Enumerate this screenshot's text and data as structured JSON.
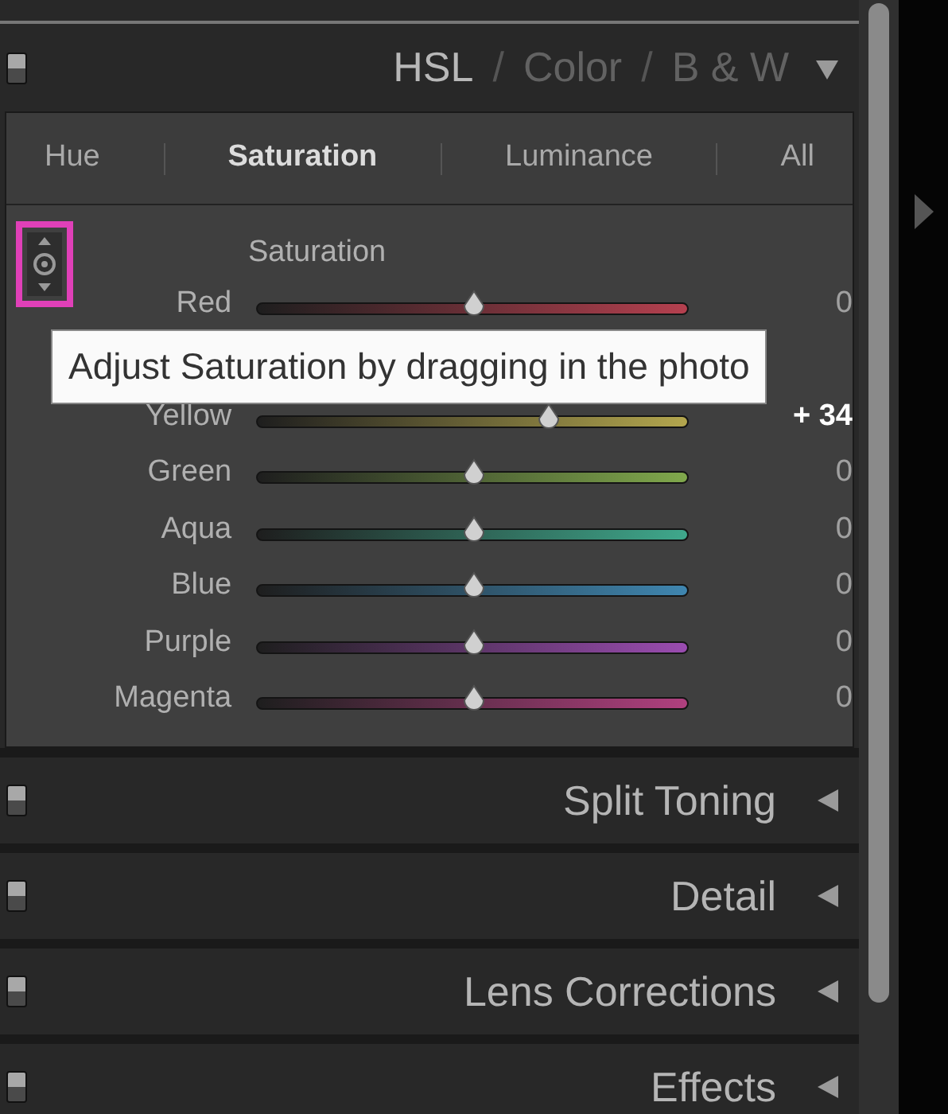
{
  "hsl_panel": {
    "title_parts": [
      {
        "label": "HSL",
        "selected": true
      },
      {
        "label": "Color",
        "selected": false
      },
      {
        "label": "B & W",
        "selected": false
      }
    ],
    "expanded": true,
    "separator": "/",
    "tabs": [
      {
        "label": "Hue",
        "selected": false
      },
      {
        "label": "Saturation",
        "selected": true
      },
      {
        "label": "Luminance",
        "selected": false
      },
      {
        "label": "All",
        "selected": false
      }
    ],
    "target_tool": {
      "highlighted": true
    },
    "group_label": "Saturation",
    "sliders": [
      {
        "name": "Red",
        "level": 0.5,
        "reading": "0",
        "modified": false,
        "color": "#b5404f"
      },
      {
        "name": "Yellow",
        "level": 0.67,
        "reading": "+ 34",
        "modified": true,
        "color": "#b3a64e"
      },
      {
        "name": "Green",
        "level": 0.5,
        "reading": "0",
        "modified": false,
        "color": "#80a84c"
      },
      {
        "name": "Aqua",
        "level": 0.5,
        "reading": "0",
        "modified": false,
        "color": "#3fa88c"
      },
      {
        "name": "Blue",
        "level": 0.5,
        "reading": "0",
        "modified": false,
        "color": "#3f86b0"
      },
      {
        "name": "Purple",
        "level": 0.5,
        "reading": "0",
        "modified": false,
        "color": "#9a4cb0"
      },
      {
        "name": "Magenta",
        "level": 0.5,
        "reading": "0",
        "modified": false,
        "color": "#b0407f"
      }
    ],
    "tooltip": "Adjust Saturation by dragging in the photo"
  },
  "sections": [
    {
      "title": "Split Toning",
      "expanded": false
    },
    {
      "title": "Detail",
      "expanded": false
    },
    {
      "title": "Lens Corrections",
      "expanded": false
    },
    {
      "title": "Effects",
      "expanded": false
    }
  ]
}
